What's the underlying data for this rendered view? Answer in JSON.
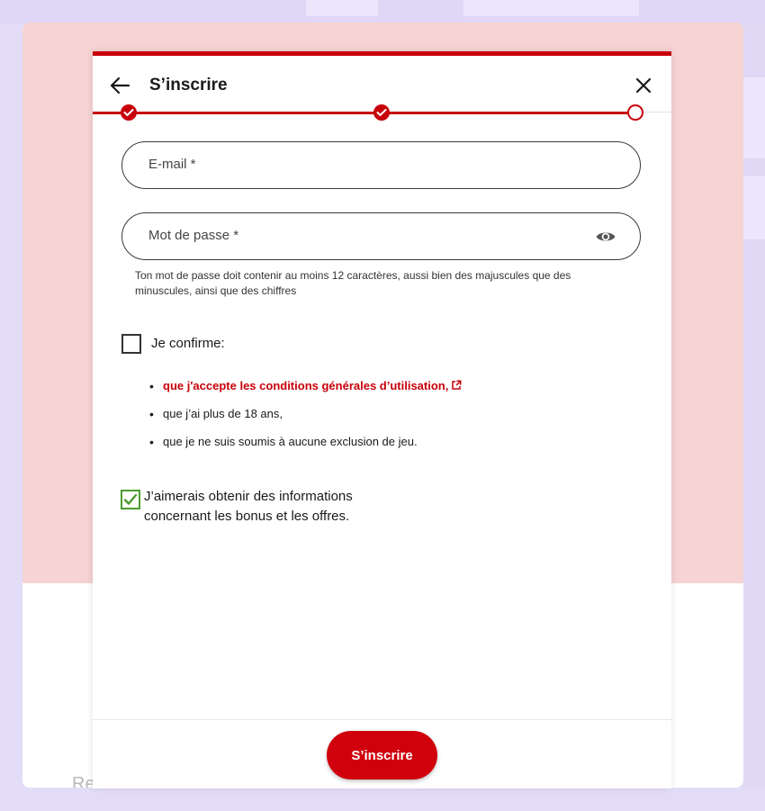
{
  "page": {
    "background_text": "Re",
    "colors": {
      "brand_red": "#c8000a",
      "check_green": "#4c9c2e",
      "pink_bg": "#f6d4d4"
    }
  },
  "modal": {
    "title": "S’inscrire",
    "back_icon": "arrow-left-icon",
    "close_icon": "close-icon",
    "stepper": {
      "total_steps": 3,
      "completed_steps": 2,
      "current_step": 3
    }
  },
  "form": {
    "email": {
      "label": "E-mail *",
      "value": ""
    },
    "password": {
      "label": "Mot de passe *",
      "value": "",
      "toggle_icon": "eye-icon"
    },
    "password_hint": "Ton mot de passe doit contenir au moins 12 caractères, aussi bien des majuscules que des minuscules, ainsi que des chiffres",
    "confirm": {
      "label": "Je confirme:",
      "checked": false,
      "items": [
        {
          "text": "que j'accepte les conditions générales d’utilisation,",
          "link": true,
          "icon": "external-link-icon"
        },
        {
          "text": "que j’ai plus de 18 ans,"
        },
        {
          "text": "que je ne suis soumis à aucune exclusion de jeu."
        }
      ]
    },
    "newsletter": {
      "line1": "J’aimerais obtenir des informations",
      "line2": "concernant les bonus et les offres.",
      "checked": true
    }
  },
  "footer": {
    "submit_label": "S’inscrire"
  }
}
